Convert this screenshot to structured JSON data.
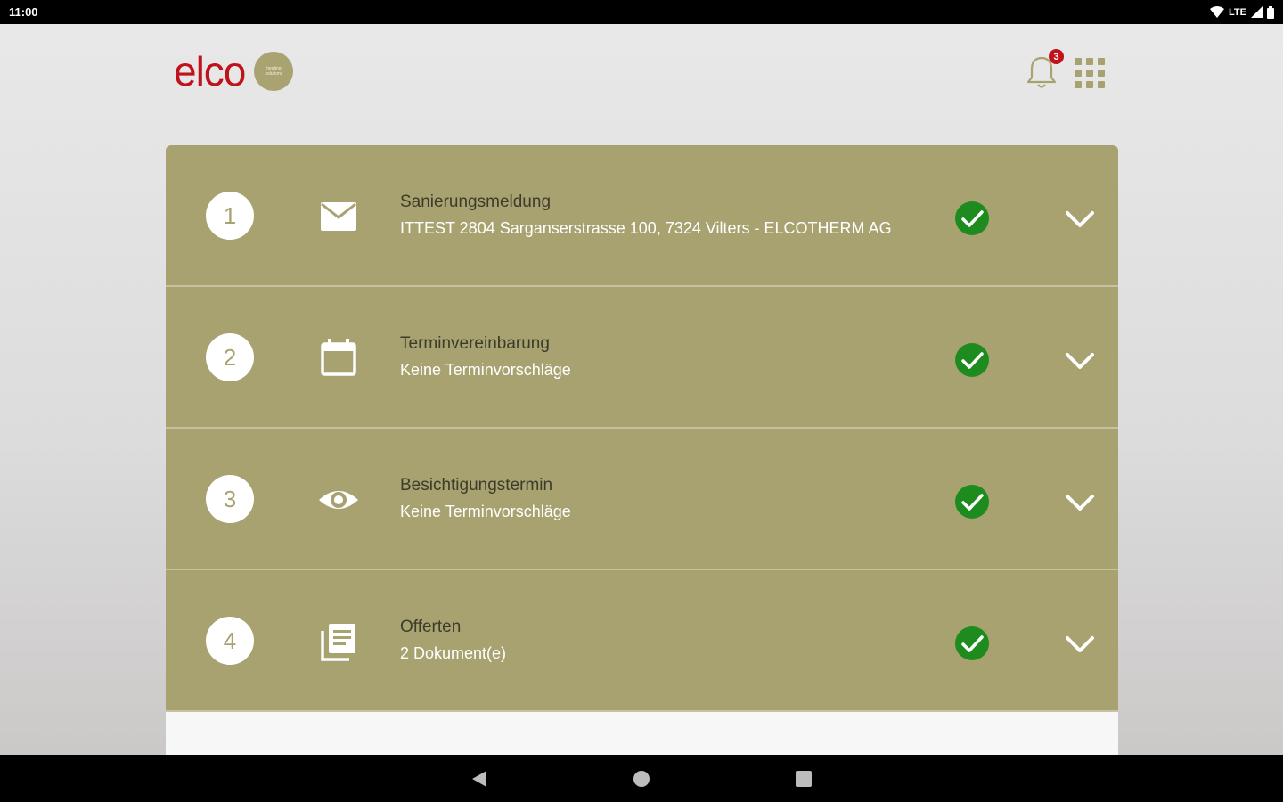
{
  "status_bar": {
    "time": "11:00",
    "network": "LTE"
  },
  "header": {
    "logo_text": "elco",
    "logo_badge_lines": [
      "heating",
      "solutions"
    ],
    "notifications_count": "3"
  },
  "steps": [
    {
      "number": "1",
      "icon": "mail-icon",
      "title": "Sanierungsmeldung",
      "subtitle": "ITTEST 2804 Sarganserstrasse 100, 7324 Vilters - ELCOTHERM AG",
      "status": "done"
    },
    {
      "number": "2",
      "icon": "calendar-icon",
      "title": "Terminvereinbarung",
      "subtitle": "Keine Terminvorschläge",
      "status": "done"
    },
    {
      "number": "3",
      "icon": "eye-icon",
      "title": "Besichtigungstermin",
      "subtitle": "Keine Terminvorschläge",
      "status": "done"
    },
    {
      "number": "4",
      "icon": "documents-icon",
      "title": "Offerten",
      "subtitle": "2 Dokument(e)",
      "status": "done"
    }
  ],
  "colors": {
    "brand_red": "#c0121a",
    "step_background": "#a8a271",
    "check_green": "#1e8b1e"
  }
}
